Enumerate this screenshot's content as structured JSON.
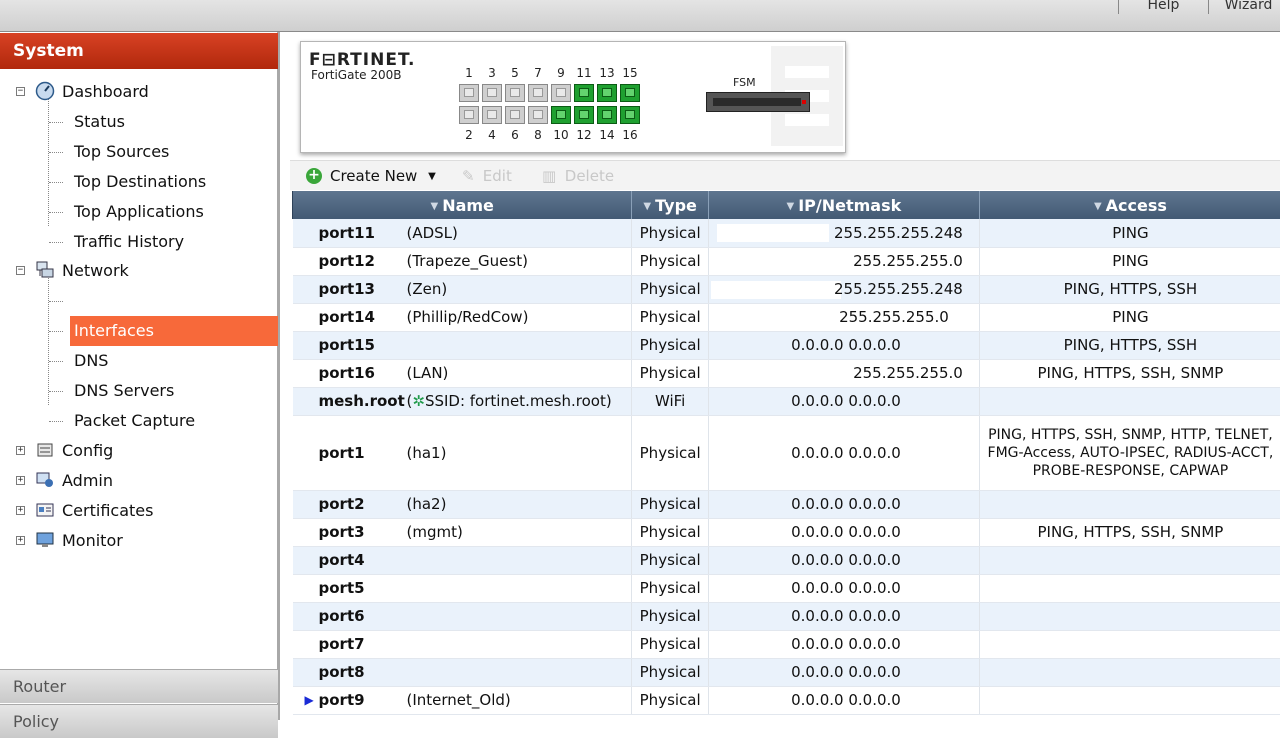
{
  "topbar": {
    "help": "Help",
    "wizard": "Wizard"
  },
  "sidebar": {
    "header": "System",
    "items": [
      {
        "label": "Dashboard",
        "icon": "dashboard-icon",
        "expander": "⊟"
      },
      {
        "label": "Status"
      },
      {
        "label": "Top Sources"
      },
      {
        "label": "Top Destinations"
      },
      {
        "label": "Top Applications"
      },
      {
        "label": "Traffic History"
      },
      {
        "label": "Network",
        "icon": "network-icon",
        "expander": "⊟"
      },
      {
        "label": "Interfaces"
      },
      {
        "label": "DNS"
      },
      {
        "label": "DNS Servers"
      },
      {
        "label": "Packet Capture"
      },
      {
        "label": "Config",
        "icon": "config-icon",
        "expander": "⊞"
      },
      {
        "label": "Admin",
        "icon": "admin-icon",
        "expander": "⊞"
      },
      {
        "label": "Certificates",
        "icon": "certificates-icon",
        "expander": "⊞"
      },
      {
        "label": "Monitor",
        "icon": "monitor-icon",
        "expander": "⊞"
      }
    ],
    "footer_router": "Router",
    "footer_policy": "Policy"
  },
  "device": {
    "logo": "F⊟RTINET.",
    "model": "FortiGate 200B",
    "top_ports": [
      "1",
      "3",
      "5",
      "7",
      "9",
      "11",
      "13",
      "15"
    ],
    "bottom_ports": [
      "2",
      "4",
      "6",
      "8",
      "10",
      "12",
      "14",
      "16"
    ],
    "fsm": "FSM"
  },
  "toolbar": {
    "create_new": "Create New",
    "edit": "Edit",
    "delete": "Delete"
  },
  "table": {
    "headers": {
      "name": "Name",
      "type": "Type",
      "ip": "IP/Netmask",
      "access": "Access"
    },
    "rows": [
      {
        "port": "port11",
        "alias": "(ADSL)",
        "type": "Physical",
        "ip": "255.255.255.248",
        "access": "PING"
      },
      {
        "port": "port12",
        "alias": "(Trapeze_Guest)",
        "type": "Physical",
        "ip": "255.255.255.0",
        "access": "PING"
      },
      {
        "port": "port13",
        "alias": "(Zen)",
        "type": "Physical",
        "ip": "255.255.255.248",
        "access": "PING, HTTPS, SSH"
      },
      {
        "port": "port14",
        "alias": "(Phillip/RedCow)",
        "type": "Physical",
        "ip": "255.255.255.0",
        "access": "PING"
      },
      {
        "port": "port15",
        "alias": "",
        "type": "Physical",
        "ip": "0.0.0.0 0.0.0.0",
        "access": "PING, HTTPS, SSH"
      },
      {
        "port": "port16",
        "alias": "(LAN)",
        "type": "Physical",
        "ip": "255.255.255.0",
        "access": "PING, HTTPS, SSH, SNMP"
      },
      {
        "port": "mesh.root",
        "alias": "SSID: fortinet.mesh.root)",
        "type": "WiFi",
        "ip": "0.0.0.0 0.0.0.0",
        "access": ""
      },
      {
        "port": "port1",
        "alias": "(ha1)",
        "type": "Physical",
        "ip": "0.0.0.0 0.0.0.0",
        "access": "PING, HTTPS, SSH, SNMP, HTTP, TELNET, FMG-Access, AUTO-IPSEC, RADIUS-ACCT, PROBE-RESPONSE, CAPWAP"
      },
      {
        "port": "port2",
        "alias": "(ha2)",
        "type": "Physical",
        "ip": "0.0.0.0 0.0.0.0",
        "access": ""
      },
      {
        "port": "port3",
        "alias": "(mgmt)",
        "type": "Physical",
        "ip": "0.0.0.0 0.0.0.0",
        "access": "PING, HTTPS, SSH, SNMP"
      },
      {
        "port": "port4",
        "alias": "",
        "type": "Physical",
        "ip": "0.0.0.0 0.0.0.0",
        "access": ""
      },
      {
        "port": "port5",
        "alias": "",
        "type": "Physical",
        "ip": "0.0.0.0 0.0.0.0",
        "access": ""
      },
      {
        "port": "port6",
        "alias": "",
        "type": "Physical",
        "ip": "0.0.0.0 0.0.0.0",
        "access": ""
      },
      {
        "port": "port7",
        "alias": "",
        "type": "Physical",
        "ip": "0.0.0.0 0.0.0.0",
        "access": ""
      },
      {
        "port": "port8",
        "alias": "",
        "type": "Physical",
        "ip": "0.0.0.0 0.0.0.0",
        "access": ""
      },
      {
        "port": "port9",
        "alias": "(Internet_Old)",
        "type": "Physical",
        "ip": "0.0.0.0 0.0.0.0",
        "access": ""
      }
    ]
  }
}
